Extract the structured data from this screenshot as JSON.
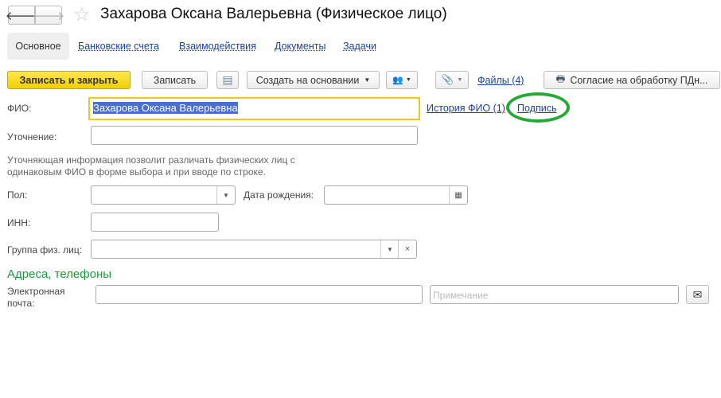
{
  "title": "Захарова Оксана Валерьевна (Физическое лицо)",
  "tabs": [
    "Основное",
    "Банковские счета",
    "Взаимодействия",
    "Документы",
    "Задачи"
  ],
  "toolbar": {
    "save_close": "Записать и закрыть",
    "save": "Записать",
    "create_based": "Создать на основании",
    "files": "Файлы (4)",
    "consent": "Согласие на обработку ПДн..."
  },
  "form": {
    "fio_label": "ФИО:",
    "fio_value": "Захарова Оксана Валерьевна",
    "history_link": "История ФИО (1)",
    "signature_link": "Подпись",
    "clarify_label": "Уточнение:",
    "clarify_hint": "Уточняющая информация позволит различать физических лиц  с одинаковым ФИО в форме выбора и при вводе по строке.",
    "gender_label": "Пол:",
    "birth_label": "Дата рождения:",
    "inn_label": "ИНН:",
    "group_label": "Группа физ. лиц:",
    "section_contacts": "Адреса, телефоны",
    "email_label": "Электронная почта:",
    "note_placeholder": "Примечание"
  },
  "colors": {
    "accent_yellow": "#f5d800",
    "link": "#1a3fa8",
    "section": "#1a9a3a",
    "highlight": "#4a6fcf",
    "annotation": "#22aa33"
  }
}
